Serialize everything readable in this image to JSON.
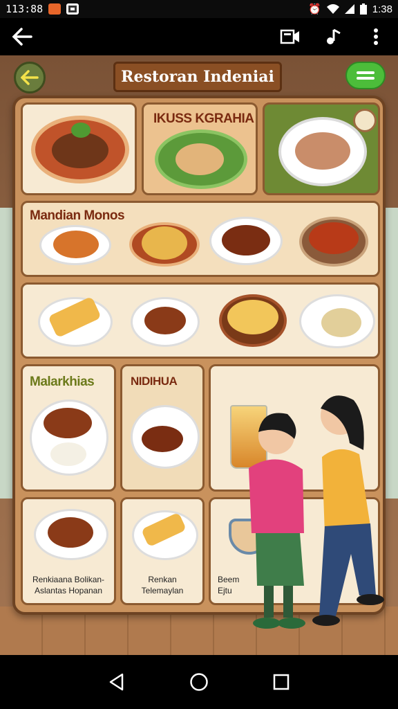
{
  "status_bar": {
    "time_left": "113:88",
    "time_right": "1:38",
    "icons": [
      "app-badge-orange-icon",
      "app-badge-white-icon",
      "alarm-icon",
      "wifi-icon",
      "signal-icon",
      "battery-icon"
    ]
  },
  "app_bar": {
    "icons": [
      "back-arrow-icon",
      "screen-share-icon",
      "music-note-icon",
      "more-vert-icon"
    ]
  },
  "board": {
    "title": "Restoran Indeniai"
  },
  "sections": {
    "top_middle_title": "IKUSS KGRAHIA",
    "row2_title": "Mandian Monos",
    "row4_left_title": "Malarkhias",
    "row4_mid_title": "NIDIHUA",
    "row5_left_caption": "Renkiaana Bolikan-\nAslantas Hopanan",
    "row5_mid_caption": "Renkan\nTelemaylan",
    "row5_right_caption": "Beem\nEjtu"
  },
  "colors": {
    "board_frame": "#6d4323",
    "title_plank": "#8a4f24",
    "menu_pill": "#4cbd3a",
    "card_cream": "#f7ead3",
    "card_green": "#6e8a34",
    "title_red": "#7a2a10",
    "title_olive": "#6c7a1a"
  }
}
